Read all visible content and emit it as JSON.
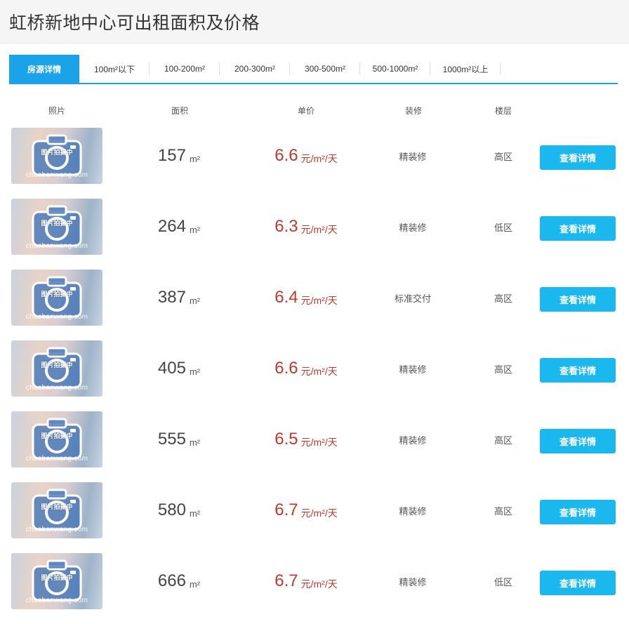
{
  "page": {
    "title": "虹桥新地中心可出租面积及价格"
  },
  "tabs": [
    {
      "label": "房源详情",
      "active": true
    },
    {
      "label": "100m²以下"
    },
    {
      "label": "100-200m²"
    },
    {
      "label": "200-300m²"
    },
    {
      "label": "300-500m²"
    },
    {
      "label": "500-1000m²"
    },
    {
      "label": "1000m²以上"
    }
  ],
  "columns": {
    "photo": "照片",
    "area": "面积",
    "price": "单价",
    "decoration": "装修",
    "floor": "楼层"
  },
  "units": {
    "area": "m²",
    "price": "元/m²/天"
  },
  "photo_placeholder": {
    "text": "图片拍摄中",
    "watermark": "chaobanwang.com"
  },
  "listings": [
    {
      "area": "157",
      "price": "6.6",
      "decoration": "精装修",
      "floor": "高区",
      "action": "查看详情"
    },
    {
      "area": "264",
      "price": "6.3",
      "decoration": "精装修",
      "floor": "低区",
      "action": "查看详情"
    },
    {
      "area": "387",
      "price": "6.4",
      "decoration": "标准交付",
      "floor": "高区",
      "action": "查看详情"
    },
    {
      "area": "405",
      "price": "6.6",
      "decoration": "精装修",
      "floor": "高区",
      "action": "查看详情"
    },
    {
      "area": "555",
      "price": "6.5",
      "decoration": "精装修",
      "floor": "高区",
      "action": "查看详情"
    },
    {
      "area": "580",
      "price": "6.7",
      "decoration": "精装修",
      "floor": "高区",
      "action": "查看详情"
    },
    {
      "area": "666",
      "price": "6.7",
      "decoration": "精装修",
      "floor": "低区",
      "action": "查看详情"
    }
  ],
  "colors": {
    "accent": "#1aa3e8",
    "button": "#1ab8ee",
    "price": "#c0392b"
  }
}
